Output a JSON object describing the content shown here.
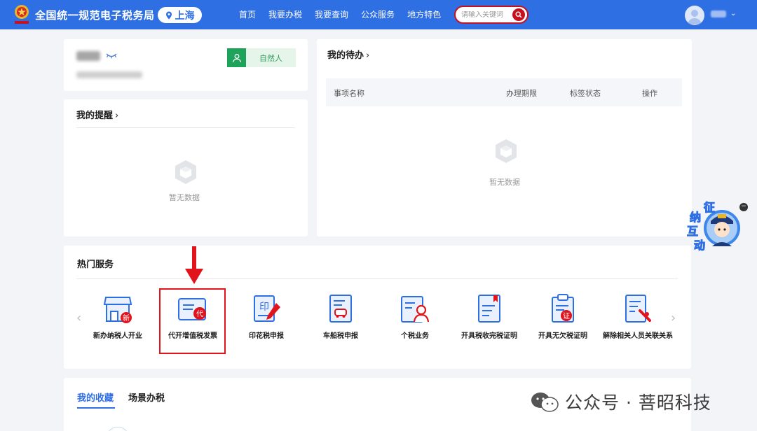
{
  "header": {
    "site_title": "全国统一规范电子税务局",
    "region": "上海",
    "nav": [
      "首页",
      "我要办税",
      "我要查询",
      "公众服务",
      "地方特色"
    ],
    "search_placeholder": "请输入关键词"
  },
  "profile": {
    "person_type": "自然人"
  },
  "reminders": {
    "title": "我的提醒",
    "empty_text": "暂无数据"
  },
  "todo": {
    "title": "我的待办",
    "columns": [
      "事项名称",
      "办理期限",
      "标签状态",
      "操作"
    ],
    "empty_text": "暂无数据"
  },
  "hot_services": {
    "title": "热门服务",
    "items": [
      {
        "label": "新办纳税人开业",
        "badge": "新"
      },
      {
        "label": "代开增值税发票",
        "badge": "代"
      },
      {
        "label": "印花税申报",
        "badge": ""
      },
      {
        "label": "车船税申报",
        "badge": ""
      },
      {
        "label": "个税业务",
        "badge": ""
      },
      {
        "label": "开具税收完税证明",
        "badge": ""
      },
      {
        "label": "开具无欠税证明",
        "badge": "证"
      },
      {
        "label": "解除相关人员关联关系",
        "badge": ""
      }
    ],
    "highlighted_item": "代开增值税发票"
  },
  "favorites": {
    "tabs": [
      "我的收藏",
      "场景办税"
    ],
    "active_tab": "我的收藏"
  },
  "assistant": {
    "label_chars": [
      "征",
      "纳",
      "互",
      "动"
    ],
    "close": "−"
  },
  "watermark": "公众号 · 菩昭科技",
  "colors": {
    "primary": "#2f6fe4",
    "accent_red": "#e1141c",
    "green": "#1ea35a"
  }
}
